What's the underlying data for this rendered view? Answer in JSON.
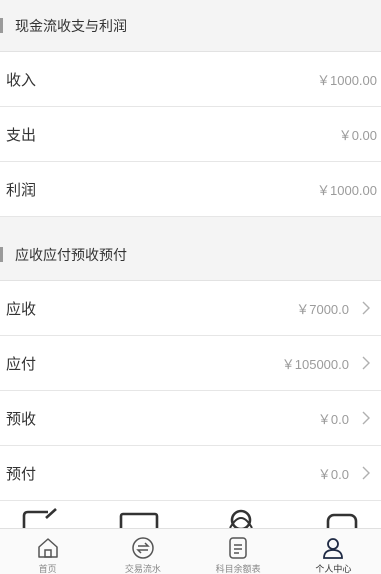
{
  "cashflow": {
    "title": "现金流收支与利润",
    "rows": [
      {
        "label": "收入",
        "value": "￥1000.00"
      },
      {
        "label": "支出",
        "value": "￥0.00"
      },
      {
        "label": "利润",
        "value": "￥1000.00"
      }
    ]
  },
  "receivables": {
    "title": "应收应付预收预付",
    "rows": [
      {
        "label": "应收",
        "value": "￥7000.0"
      },
      {
        "label": "应付",
        "value": "￥105000.0"
      },
      {
        "label": "预收",
        "value": "￥0.0"
      },
      {
        "label": "预付",
        "value": "￥0.0"
      }
    ]
  },
  "tabbar": {
    "active": "个人中心",
    "tabs": [
      {
        "label": "首页",
        "icon": "home-icon"
      },
      {
        "label": "交易流水",
        "icon": "exchange-icon"
      },
      {
        "label": "科目余额表",
        "icon": "ledger-icon"
      },
      {
        "label": "个人中心",
        "icon": "person-icon"
      }
    ]
  },
  "colors": {
    "accent": "#9a9a9a",
    "text": "#333333",
    "muted": "#9b9b9b",
    "section_bg": "#f4f4f4"
  }
}
